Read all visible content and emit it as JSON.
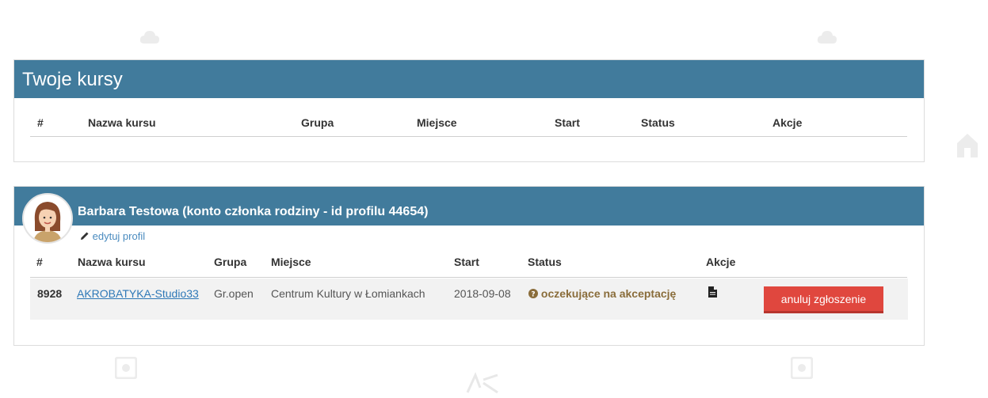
{
  "courses_panel": {
    "title": "Twoje kursy",
    "columns": [
      "#",
      "Nazwa kursu",
      "Grupa",
      "Miejsce",
      "Start",
      "Status",
      "Akcje"
    ]
  },
  "profile_panel": {
    "name": "Barbara Testowa (konto członka rodziny - id profilu 44654)",
    "edit_label": "edytuj profil",
    "columns": [
      "#",
      "Nazwa kursu",
      "Grupa",
      "Miejsce",
      "Start",
      "Status",
      "Akcje"
    ],
    "rows": [
      {
        "id": "8928",
        "course": "AKROBATYKA-Studio33",
        "group": "Gr.open",
        "place": "Centrum Kultury w Łomiankach",
        "start": "2018-09-08",
        "status": "oczekujące na akceptację",
        "status_icon": "question-circle-icon",
        "action_icon": "document-icon",
        "cancel_label": "anuluj zgłoszenie"
      }
    ]
  },
  "colors": {
    "header_bg": "#417b9c",
    "cancel_button": "#e0473e",
    "status_text": "#8a6d3b",
    "link": "#2e78b7"
  }
}
